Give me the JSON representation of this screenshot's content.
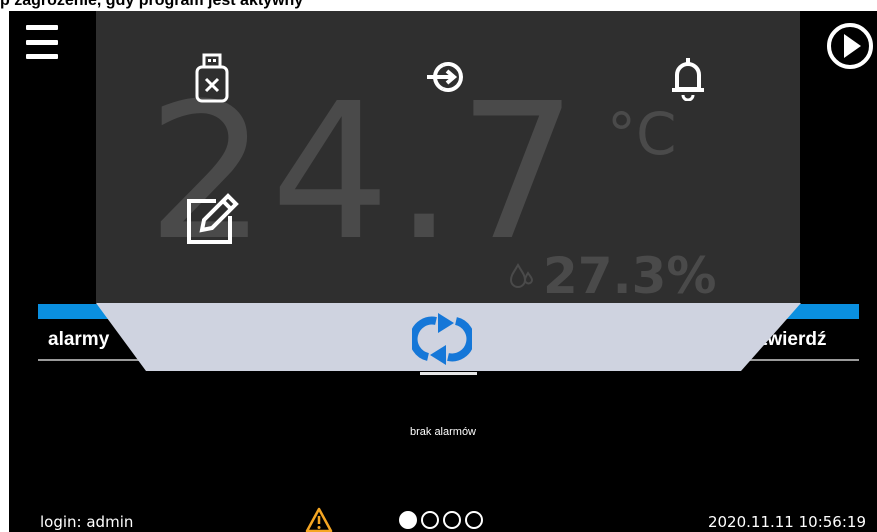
{
  "caption": "p zagrożenie, gdy program jest aktywny",
  "main": {
    "temperature": "24.7",
    "temperature_unit": "°C",
    "humidity": "27.3%"
  },
  "tabs": {
    "alarms_label": "alarmy",
    "confirm_label": "twierdź"
  },
  "alarm_list": {
    "empty_text": "brak alarmów"
  },
  "status_bar": {
    "login": "login: admin",
    "datetime": "2020.11.11  10:56:19",
    "pages": {
      "total": 4,
      "active": 1
    }
  },
  "colors": {
    "accent_blue": "#0a8fe0",
    "panel_gray": "#2f2f2f",
    "dim_text": "#4a4a4a",
    "sync_bar": "#cfd3e0",
    "warning_orange": "#f5a623"
  },
  "icons": [
    "menu-icon",
    "play-icon",
    "usb-icon",
    "login-icon",
    "bell-icon",
    "edit-icon",
    "humidity-icon",
    "sync-icon",
    "warning-icon"
  ]
}
